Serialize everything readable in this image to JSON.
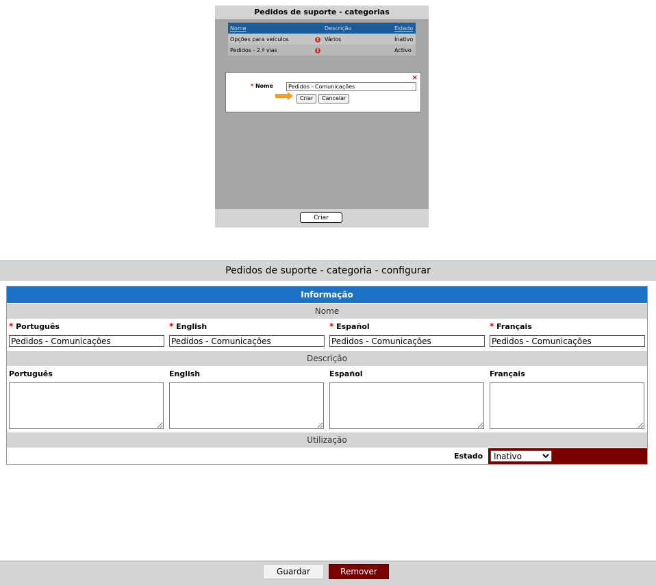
{
  "category_window": {
    "title": "Pedidos de suporte - categorias",
    "columns": [
      "Nome",
      "Descrição",
      "Estado"
    ],
    "rows": [
      {
        "name": "Opções para veículos",
        "description": "Vários",
        "status": "Inativo"
      },
      {
        "name": "Pedidos - 2.ª vias",
        "description": "",
        "status": "Activo"
      }
    ],
    "warning_icon": "!",
    "new_panel": {
      "close_label": "×",
      "name_label": "Nome",
      "name_value": "Pedidos - Comunicações",
      "create_label": "Criar",
      "cancel_label": "Cancelar"
    },
    "footer_create_label": "Criar"
  },
  "config": {
    "title": "Pedidos de suporte - categoria - configurar",
    "info_header": "Informação",
    "name_section": "Nome",
    "description_section": "Descrição",
    "usage_section": "Utilização",
    "required_mark": "*",
    "languages": [
      "Português",
      "English",
      "Español",
      "Français"
    ],
    "name_values": [
      "Pedidos - Comunicações",
      "Pedidos - Comunicações",
      "Pedidos - Comunicações",
      "Pedidos - Comunicações"
    ],
    "status_label": "Estado",
    "status_value": "Inativo",
    "status_options": [
      "Inativo"
    ],
    "save_label": "Guardar",
    "remove_label": "Remover"
  },
  "colors": {
    "header_blue": "#1c72c5",
    "dark_red": "#7a0000",
    "required_red": "#dd0000",
    "arrow_orange": "#f39c27"
  }
}
